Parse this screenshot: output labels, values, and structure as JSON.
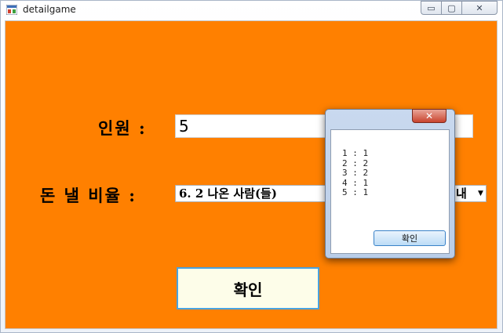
{
  "window": {
    "title": "detailgame",
    "controls": {
      "minimize": "▭",
      "maximize": "▢",
      "close": "✕"
    }
  },
  "form": {
    "people_label": "인원 :",
    "people_value": "5",
    "ratio_label": "돈 낼 비율 :",
    "ratio_selected": "6. 2 나온 사람(들)",
    "ratio_selected_tail": "내",
    "ok_label": "확인"
  },
  "dialog": {
    "close_label": "✕",
    "lines": [
      "1 : 1",
      "2 : 2",
      "3 : 2",
      "4 : 1",
      "5 : 1"
    ],
    "ok_label": "확인"
  },
  "colors": {
    "background": "#ff8000",
    "ok_fill": "#fdfde9",
    "ok_border": "#4aa3df"
  }
}
